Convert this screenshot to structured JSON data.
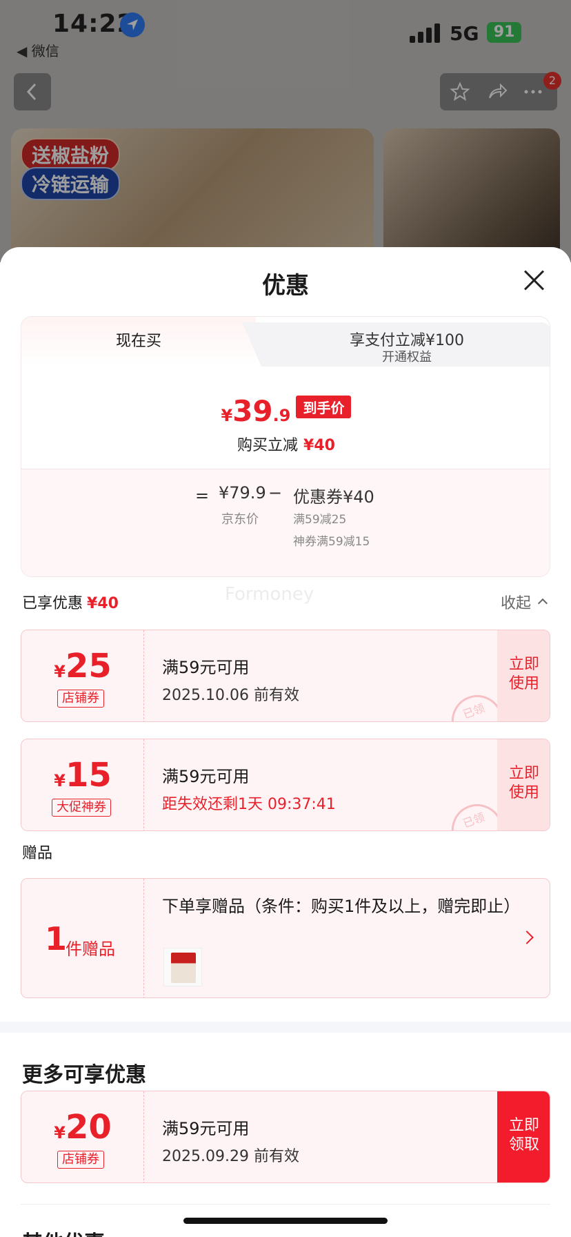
{
  "status": {
    "time": "14:22",
    "back_app": "◀ 微信",
    "network": "5G",
    "battery": "91"
  },
  "nav": {
    "badge": "2"
  },
  "banner": {
    "tag1": "送椒盐粉",
    "tag2": "冷链运输"
  },
  "sheet": {
    "title": "优惠",
    "tabs": {
      "now": "现在买",
      "pay_line1": "享支付立减¥100",
      "pay_line2": "开通权益"
    },
    "price": {
      "yen": "¥",
      "integer": "39",
      "decimal": ".9",
      "tag": "到手价"
    },
    "save": {
      "label": "购买立减",
      "amount": "¥40"
    },
    "calc": {
      "eq": "=",
      "orig": "¥79.9",
      "orig_label": "京东价",
      "minus": "−",
      "coupon": "优惠券¥40",
      "coupon_detail1": "满59减25",
      "coupon_detail2": "神券满59减15"
    },
    "watermark": "Formoney",
    "enjoyed": {
      "label": "已享优惠",
      "amount": "¥40",
      "collapse": "收起"
    }
  },
  "coupons": [
    {
      "yen": "¥",
      "amount": "25",
      "type": "店铺券",
      "condition": "满59元可用",
      "valid": "2025.10.06 前有效",
      "action_line1": "立即",
      "action_line2": "使用",
      "stamp": "已领"
    },
    {
      "yen": "¥",
      "amount": "15",
      "type": "大促神券",
      "condition": "满59元可用",
      "valid": "距失效还剩1天 09:37:41",
      "action_line1": "立即",
      "action_line2": "使用",
      "stamp": "已领"
    }
  ],
  "gift": {
    "title": "赠品",
    "count": "1",
    "unit": "件赠品",
    "desc": "下单享赠品（条件：购买1件及以上，赠完即止）"
  },
  "more": {
    "title": "更多可享优惠",
    "coupon": {
      "yen": "¥",
      "amount": "20",
      "type": "店铺券",
      "condition": "满59元可用",
      "valid": "2025.09.29 前有效",
      "action_line1": "立即",
      "action_line2": "领取"
    }
  },
  "other": {
    "title": "其他优惠"
  },
  "colors": {
    "accent": "#e8202a",
    "coupon_bg": "#fff4f5"
  }
}
